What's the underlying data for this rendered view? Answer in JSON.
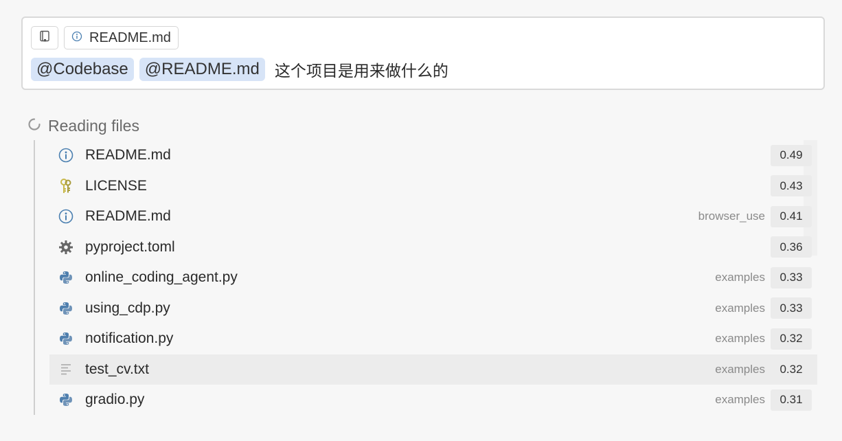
{
  "composer": {
    "context_chip_label": "README.md",
    "mentions": [
      "@Codebase",
      "@README.md"
    ],
    "prompt_text": "这个项目是用来做什么的"
  },
  "status": {
    "label": "Reading files"
  },
  "files": [
    {
      "name": "README.md",
      "folder": "",
      "score": "0.49",
      "icon": "info-icon"
    },
    {
      "name": "LICENSE",
      "folder": "",
      "score": "0.43",
      "icon": "key-icon"
    },
    {
      "name": "README.md",
      "folder": "browser_use",
      "score": "0.41",
      "icon": "info-icon"
    },
    {
      "name": "pyproject.toml",
      "folder": "",
      "score": "0.36",
      "icon": "gear-icon"
    },
    {
      "name": "online_coding_agent.py",
      "folder": "examples",
      "score": "0.33",
      "icon": "python-icon"
    },
    {
      "name": "using_cdp.py",
      "folder": "examples",
      "score": "0.33",
      "icon": "python-icon"
    },
    {
      "name": "notification.py",
      "folder": "examples",
      "score": "0.32",
      "icon": "python-icon"
    },
    {
      "name": "test_cv.txt",
      "folder": "examples",
      "score": "0.32",
      "icon": "text-file-icon"
    },
    {
      "name": "gradio.py",
      "folder": "examples",
      "score": "0.31",
      "icon": "python-icon"
    }
  ],
  "colors": {
    "mention_bg": "#d7e4f7",
    "info_icon": "#4a7fb0",
    "python_icon": "#4f7fae",
    "key_icon": "#c8b84a"
  }
}
